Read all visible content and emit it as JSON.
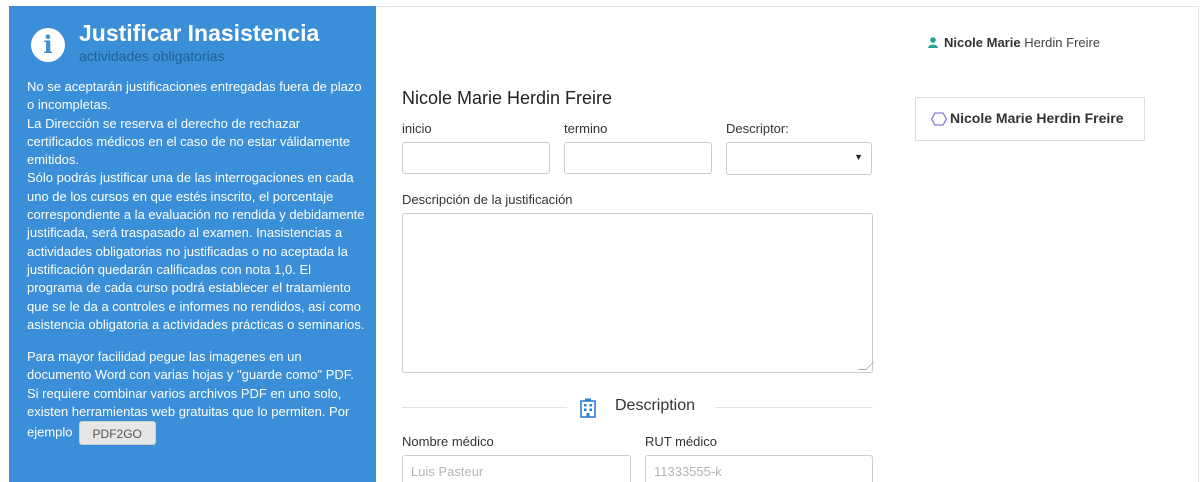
{
  "info": {
    "title": "Justificar Inasistencia",
    "subtitle": "actividades obligatorias",
    "paragraph1": "No se aceptarán justificaciones entregadas fuera de plazo o incompletas.",
    "paragraph2": "La Dirección se reserva el derecho de rechazar certificados médicos en el caso de no estar válidamente emitidos.",
    "paragraph3": "Sólo podrás justificar una de las interrogaciones en cada uno de los cursos en que estés inscrito, el porcentaje correspondiente a la evaluación no rendida y debidamente justificada, será traspasado al examen. Inasistencias a actividades obligatorias no justificadas o no aceptada la justificación quedarán calificadas con nota 1,0. El programa de cada curso podrá establecer el tratamiento que se le da a controles e informes no rendidos, así como asistencia obligatoria a actividades prácticas o seminarios.",
    "paragraph4": "Para mayor facilidad pegue las imagenes en un documento Word con varias hojas y \"guarde como\" PDF. Si requiere combinar varios archivos PDF en uno solo, existen herramientas web gratuitas que lo permiten. Por ejemplo",
    "pdf_button": "PDF2GO"
  },
  "form": {
    "student_name": "Nicole Marie Herdin Freire",
    "inicio_label": "inicio",
    "termino_label": "termino",
    "descriptor_label": "Descriptor:",
    "descripcion_label": "Descripción de la justificación",
    "section_title": "Description",
    "nombre_medico_label": "Nombre médico",
    "nombre_medico_placeholder": "Luis Pasteur",
    "rut_medico_label": "RUT médico",
    "rut_medico_placeholder": "11333555-k"
  },
  "user": {
    "first_names": "Nicole Marie",
    "last_names": "Herdin Freire",
    "card_name": "Nicole Marie Herdin Freire"
  },
  "colors": {
    "panel_blue": "#3a8fd8",
    "subtitle_blue": "#1f5f96",
    "user_icon_teal": "#2aa198",
    "building_icon_blue": "#2f7fcf",
    "hex_icon_purple": "#8a7fd0"
  }
}
